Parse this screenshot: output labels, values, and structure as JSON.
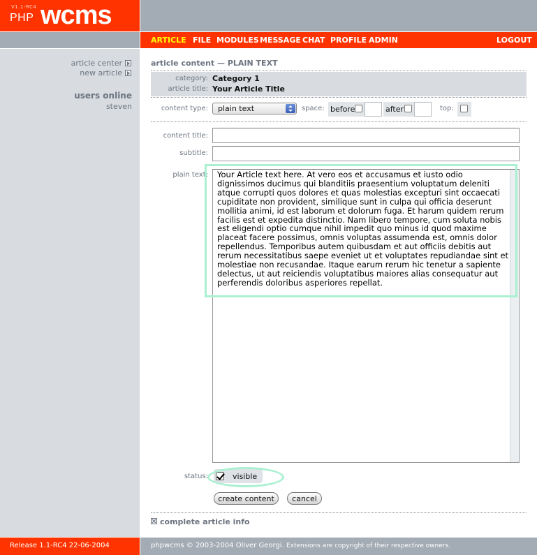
{
  "header": {
    "logo_version": "V1.1-RC4",
    "logo_php": "PHP",
    "logo_wcms": "wcms"
  },
  "nav": {
    "items": [
      "ARTICLE",
      "FILE",
      "MODULES",
      "MESSAGE",
      "CHAT",
      "PROFILE",
      "ADMIN"
    ],
    "active": "ARTICLE",
    "logout": "LOGOUT"
  },
  "sidebar": {
    "links": [
      "article center",
      "new article"
    ],
    "users_online_title": "users online",
    "users": [
      "steven"
    ]
  },
  "form": {
    "page_title": "article content — PLAIN TEXT",
    "category_label": "category:",
    "category_value": "Category 1",
    "article_title_label": "article title:",
    "article_title_value": "Your Article Title",
    "content_type_label": "content type:",
    "content_type_value": "plain text",
    "space_label": "space:",
    "before_label": "before",
    "after_label": "after",
    "top_label": "top:",
    "content_title_label": "content title:",
    "content_title_value": "",
    "subtitle_label": "subtitle:",
    "subtitle_value": "",
    "plain_text_label": "plain text:",
    "plain_text_value": "Your Article text here. At vero eos et accusamus et iusto odio dignissimos ducimus qui blanditiis praesentium voluptatum deleniti atque corrupti quos dolores et quas molestias excepturi sint occaecati cupiditate non provident, similique sunt in culpa qui officia deserunt mollitia animi, id est laborum et dolorum fuga. Et harum quidem rerum facilis est et expedita distinctio. Nam libero tempore, cum soluta nobis est eligendi optio cumque nihil impedit quo minus id quod maxime placeat facere possimus, omnis voluptas assumenda est, omnis dolor repellendus. Temporibus autem quibusdam et aut officiis debitis aut rerum necessitatibus saepe eveniet ut et voluptates repudiandae sint et molestiae non recusandae. Itaque earum rerum hic tenetur a sapiente delectus, ut aut reiciendis voluptatibus maiores alias consequatur aut perferendis doloribus asperiores repellat.",
    "status_label": "status:",
    "visible_label": "visible",
    "visible_checked": true,
    "create_button": "create content",
    "cancel_button": "cancel",
    "info_link": "complete article info"
  },
  "footer": {
    "release": "Release 1.1-RC4 22-06-2004",
    "copyright": "phpwcms © 2003-2004 Oliver Georgi.",
    "extensions": "Extensions are copyright of their respective owners."
  },
  "colors": {
    "brand_red": "#ff3300",
    "nav_active": "#ffff00",
    "header_gray": "#a3abb5",
    "sidebar_gray": "#d8dce0",
    "highlight": "#aaf0d1"
  }
}
